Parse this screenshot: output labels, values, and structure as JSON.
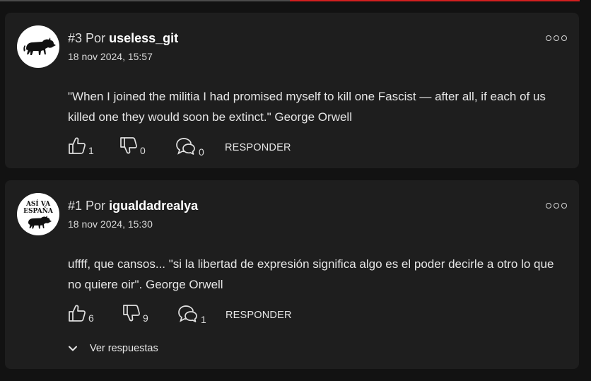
{
  "comments": [
    {
      "number": "#3",
      "por": "Por",
      "username": "useless_git",
      "date": "18 nov 2024, 15:57",
      "text": "\"When I joined the militia I had promised myself to kill one Fascist — after all, if each of us killed one they would soon be extinct.\" George Orwell",
      "likes": "1",
      "dislikes": "0",
      "replies_count": "0",
      "reply_label": "RESPONDER",
      "avatar_icon": "bull-icon"
    },
    {
      "number": "#1",
      "por": "Por",
      "username": "igualdadrealya",
      "date": "18 nov 2024, 15:30",
      "text": "uffff, que cansos... \"si la libertad de expresión significa algo es el poder decirle a otro lo que no quiere oir\". George Orwell",
      "likes": "6",
      "dislikes": "9",
      "replies_count": "1",
      "reply_label": "RESPONDER",
      "avatar_icon": "bull-icon",
      "avatar_text": [
        "ASÍ VA",
        "ESPAÑA"
      ],
      "view_replies_label": "Ver respuestas"
    }
  ],
  "colors": {
    "accent": "#d21f1f",
    "card": "#1e1e1e",
    "background": "#121212"
  }
}
